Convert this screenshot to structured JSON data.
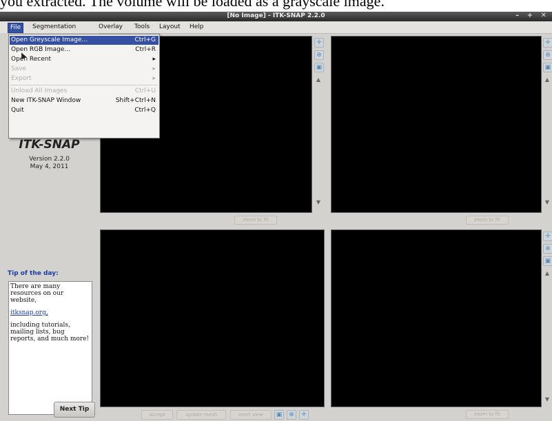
{
  "caption": "you extracted. The volume will be loaded as a grayscale image.",
  "window": {
    "title": "[No Image] - ITK-SNAP 2.2.0",
    "controls": "– + ✕"
  },
  "menubar": {
    "items": [
      "File",
      "Segmentation",
      "Overlay",
      "Tools",
      "Layout",
      "Help"
    ],
    "active": "File"
  },
  "file_menu": {
    "items": [
      {
        "label": "Open Greyscale Image...",
        "shortcut": "Ctrl+G",
        "highlighted": true
      },
      {
        "label": "Open RGB Image...",
        "shortcut": "Ctrl+R"
      },
      {
        "label": "Open Recent",
        "shortcut": "▸"
      },
      {
        "label": "Save",
        "shortcut": "▸",
        "disabled": true
      },
      {
        "label": "Export",
        "shortcut": "▸",
        "disabled": true
      },
      {
        "label": "Unload All Images",
        "shortcut": "Ctrl+U",
        "disabled": true
      },
      {
        "label": "New ITK-SNAP Window",
        "shortcut": "Shift+Ctrl+N"
      },
      {
        "label": "Quit",
        "shortcut": "Ctrl+Q"
      }
    ]
  },
  "left_panel": {
    "logo": "ITK-SNAP",
    "version": "Version 2.2.0",
    "date": "May 4, 2011",
    "tip_title": "Tip of the day:",
    "tip_text_1": "There are many resources on our website,",
    "tip_link": "itksnap.org,",
    "tip_text_2": "including tutorials, mailing lists, bug reports, and much more!",
    "next_tip": "Next Tip"
  },
  "views": {
    "zoom_to_fit": "zoom to fit",
    "bottom_buttons": [
      "accept",
      "update mesh",
      "reset view"
    ]
  },
  "icons": {
    "crosshair": "✛",
    "zoom": "⊕",
    "layout": "▣",
    "scroll_up": "▲",
    "scroll_down": "▼"
  },
  "colors": {
    "accent": "#3550a3",
    "link": "#1b3ca8",
    "view_bg": "#000000"
  }
}
